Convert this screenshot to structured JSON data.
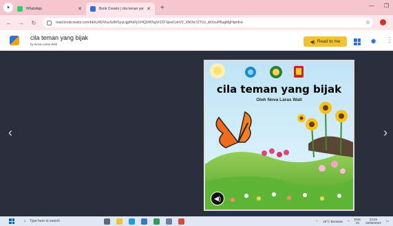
{
  "browser": {
    "tabs": [
      {
        "title": "WhatsApp",
        "color": "#25d366"
      },
      {
        "title": "Book Creator | cila teman yang",
        "color": "#2f6fdc"
      }
    ],
    "url": "read.bookcreator.com/bEKzRDVlusSdWSyuUgjiHoRy1IHQ2/WSgVr2ZFSjwoCdnV2_XNOw7ZTUz_dnScuPBugMgHqmKw"
  },
  "app": {
    "book_title": "cila teman yang bijak",
    "book_author": "by Nova Laras Wati",
    "read_to_me": "Read to me",
    "read_icon": "speaker-icon"
  },
  "cover": {
    "title": "cila teman yang bijak",
    "author": "Oleh Nova Laras Wati"
  },
  "taskbar": {
    "search_placeholder": "Type here to search",
    "weather": "25°C Berawan",
    "lang_top": "ENG",
    "lang_bottom": "IN",
    "time": "23:04",
    "date": "02/06/2024"
  },
  "colors": {
    "accent": "#f2c233",
    "brand": "#2f6fdc",
    "viewer_bg": "#2b2f3b"
  }
}
